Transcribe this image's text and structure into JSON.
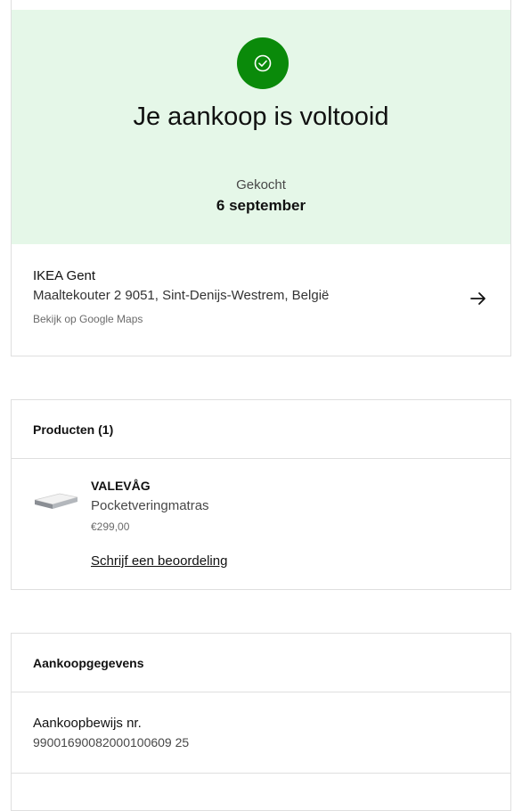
{
  "confirmation": {
    "title": "Je aankoop is voltooid",
    "bought_label": "Gekocht",
    "bought_date": "6 september",
    "icon": "check-circle-icon",
    "accent_color": "#0a8a0a",
    "background_color": "#e5f7e8"
  },
  "store": {
    "name": "IKEA Gent",
    "address": "Maaltekouter 2 9051, Sint-Denijs-Westrem, België",
    "maps_link": "Bekijk op Google Maps",
    "icon": "arrow-right-icon"
  },
  "products": {
    "title": "Producten (1)",
    "items": [
      {
        "name": "VALEVÅG",
        "description": "Pocketveringmatras",
        "price": "€299,00",
        "review_link": "Schrijf een beoordeling"
      }
    ]
  },
  "purchase_details": {
    "title": "Aankoopgegevens",
    "receipt_label": "Aankoopbewijs nr.",
    "receipt_number": "99001690082000100609 25"
  }
}
